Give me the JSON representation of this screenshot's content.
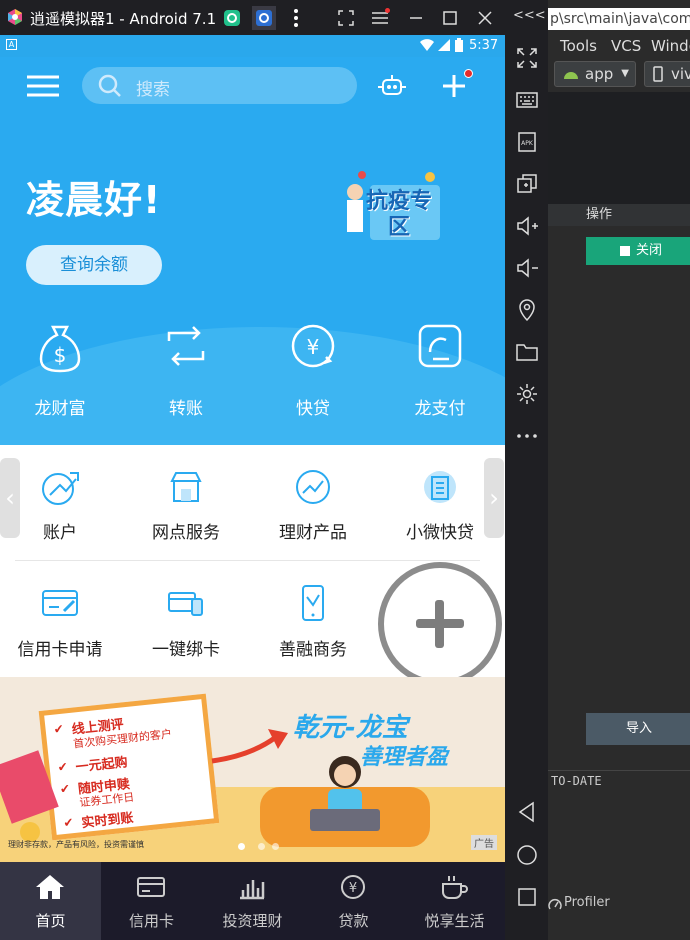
{
  "emulator": {
    "title": "逍遥模拟器1 - Android 7.1",
    "controls": [
      "minimize",
      "maximize",
      "close"
    ],
    "expand_label": "<<<"
  },
  "status_bar": {
    "time": "5:37"
  },
  "header": {
    "search_placeholder": "搜索",
    "greeting": "凌晨好!",
    "balance_button": "查询余额",
    "promo_text": "抗疫专区",
    "shortcuts": [
      {
        "label": "龙财富",
        "icon": "money-bag-icon"
      },
      {
        "label": "转账",
        "icon": "transfer-icon"
      },
      {
        "label": "快贷",
        "icon": "loan-icon"
      },
      {
        "label": "龙支付",
        "icon": "pay-icon"
      }
    ]
  },
  "services": {
    "row1": [
      {
        "label": "账户",
        "icon": "account-icon"
      },
      {
        "label": "网点服务",
        "icon": "branch-icon"
      },
      {
        "label": "理财产品",
        "icon": "finance-icon"
      },
      {
        "label": "小微快贷",
        "icon": "smallloan-icon"
      }
    ],
    "row2": [
      {
        "label": "信用卡申请",
        "icon": "card-apply-icon"
      },
      {
        "label": "一键绑卡",
        "icon": "bind-card-icon"
      },
      {
        "label": "善融商务",
        "icon": "commerce-icon"
      }
    ]
  },
  "banner": {
    "line1": "线上测评",
    "line1_sub": "首次购买理财的客户",
    "line2": "一元起购",
    "line3": "随时申赎",
    "line3_sub": "证券工作日",
    "line4": "实时到账",
    "slogan1": "乾元-龙宝",
    "slogan2": "善理者盈",
    "ad_tag": "广告",
    "disclaimer": "理财非存款，产品有风险，投资需谨慎"
  },
  "tabbar": {
    "items": [
      {
        "label": "首页",
        "active": true
      },
      {
        "label": "信用卡"
      },
      {
        "label": "投资理财"
      },
      {
        "label": "贷款"
      },
      {
        "label": "悦享生活"
      }
    ]
  },
  "ide": {
    "path": "p\\src\\main\\java\\com\\",
    "menu": [
      "Tools",
      "VCS",
      "Windo"
    ],
    "run_config": "app",
    "device": "viv",
    "operation_header": "操作",
    "close_button": "关闭",
    "import_button": "导入",
    "log_text": "TO-DATE",
    "profiler": "Profiler"
  },
  "colors": {
    "primary": "#2aaaf0",
    "tabbar": "#1c1b2a",
    "ide_green": "#19a57a",
    "accent_red": "#d72b20"
  }
}
